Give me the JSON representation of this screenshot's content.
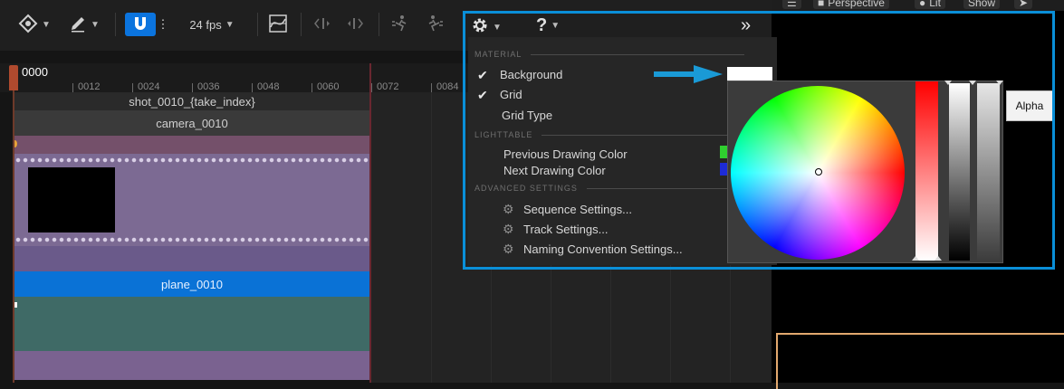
{
  "toolbar": {
    "fps_label": "24 fps",
    "transform_icon": "transform-icon",
    "pencil_icon": "pencil-icon",
    "snap_icon": "magnet-icon",
    "curve_icon": "curve-editor-icon",
    "step_icons": [
      "step-back-icon",
      "step-forward-icon"
    ],
    "run_icons": [
      "run-left-icon",
      "run-right-icon"
    ]
  },
  "viewport": {
    "perspective_label": "Perspective",
    "lit_label": "Lit",
    "show_label": "Show"
  },
  "timeline": {
    "current_frame": "0000",
    "ticks": [
      "0012",
      "0024",
      "0036",
      "0048",
      "0060",
      "0072",
      "0084"
    ],
    "shot_label": "shot_0010_{take_index}",
    "camera_label": "camera_0010",
    "plane_label": "plane_0010"
  },
  "popup": {
    "header_icons": [
      "gear-icon",
      "help-icon",
      "expand-icon"
    ],
    "sections": {
      "material": "MATERIAL",
      "lighttable": "LIGHTTABLE",
      "advanced": "ADVANCED SETTINGS"
    },
    "items": {
      "background": "Background",
      "grid": "Grid",
      "grid_type": "Grid Type",
      "previous_drawing_color": "Previous Drawing Color",
      "next_drawing_color": "Next Drawing Color",
      "sequence_settings": "Sequence Settings...",
      "track_settings": "Track Settings...",
      "naming_settings": "Naming Convention Settings..."
    },
    "colors": {
      "background_swatch": "#ffffff",
      "previous_drawing_swatch": "#2fd02f",
      "next_drawing_swatch": "#1d2bd8",
      "highlight_border": "#0a8fd8"
    }
  },
  "color_picker": {
    "alpha_label": "Alpha"
  }
}
